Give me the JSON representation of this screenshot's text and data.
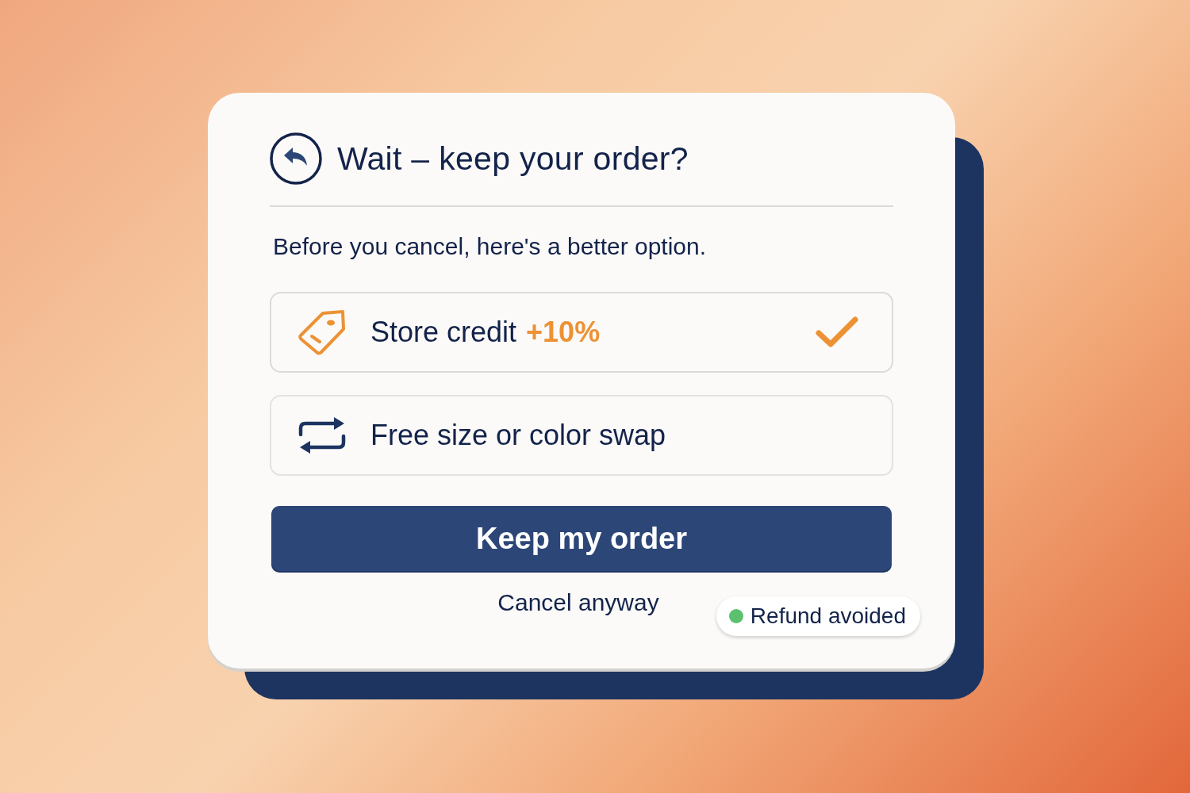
{
  "dialog": {
    "title": "Wait – keep your order?",
    "subtitle": "Before you cancel, here's a better option.",
    "options": [
      {
        "label": "Store credit",
        "highlight": "+10%",
        "selected": true
      },
      {
        "label": "Free size or color swap",
        "selected": false
      }
    ],
    "primary_button": "Keep my order",
    "secondary_link": "Cancel anyway",
    "status_badge": {
      "label": "Refund avoided",
      "color": "#5cc06f"
    }
  }
}
